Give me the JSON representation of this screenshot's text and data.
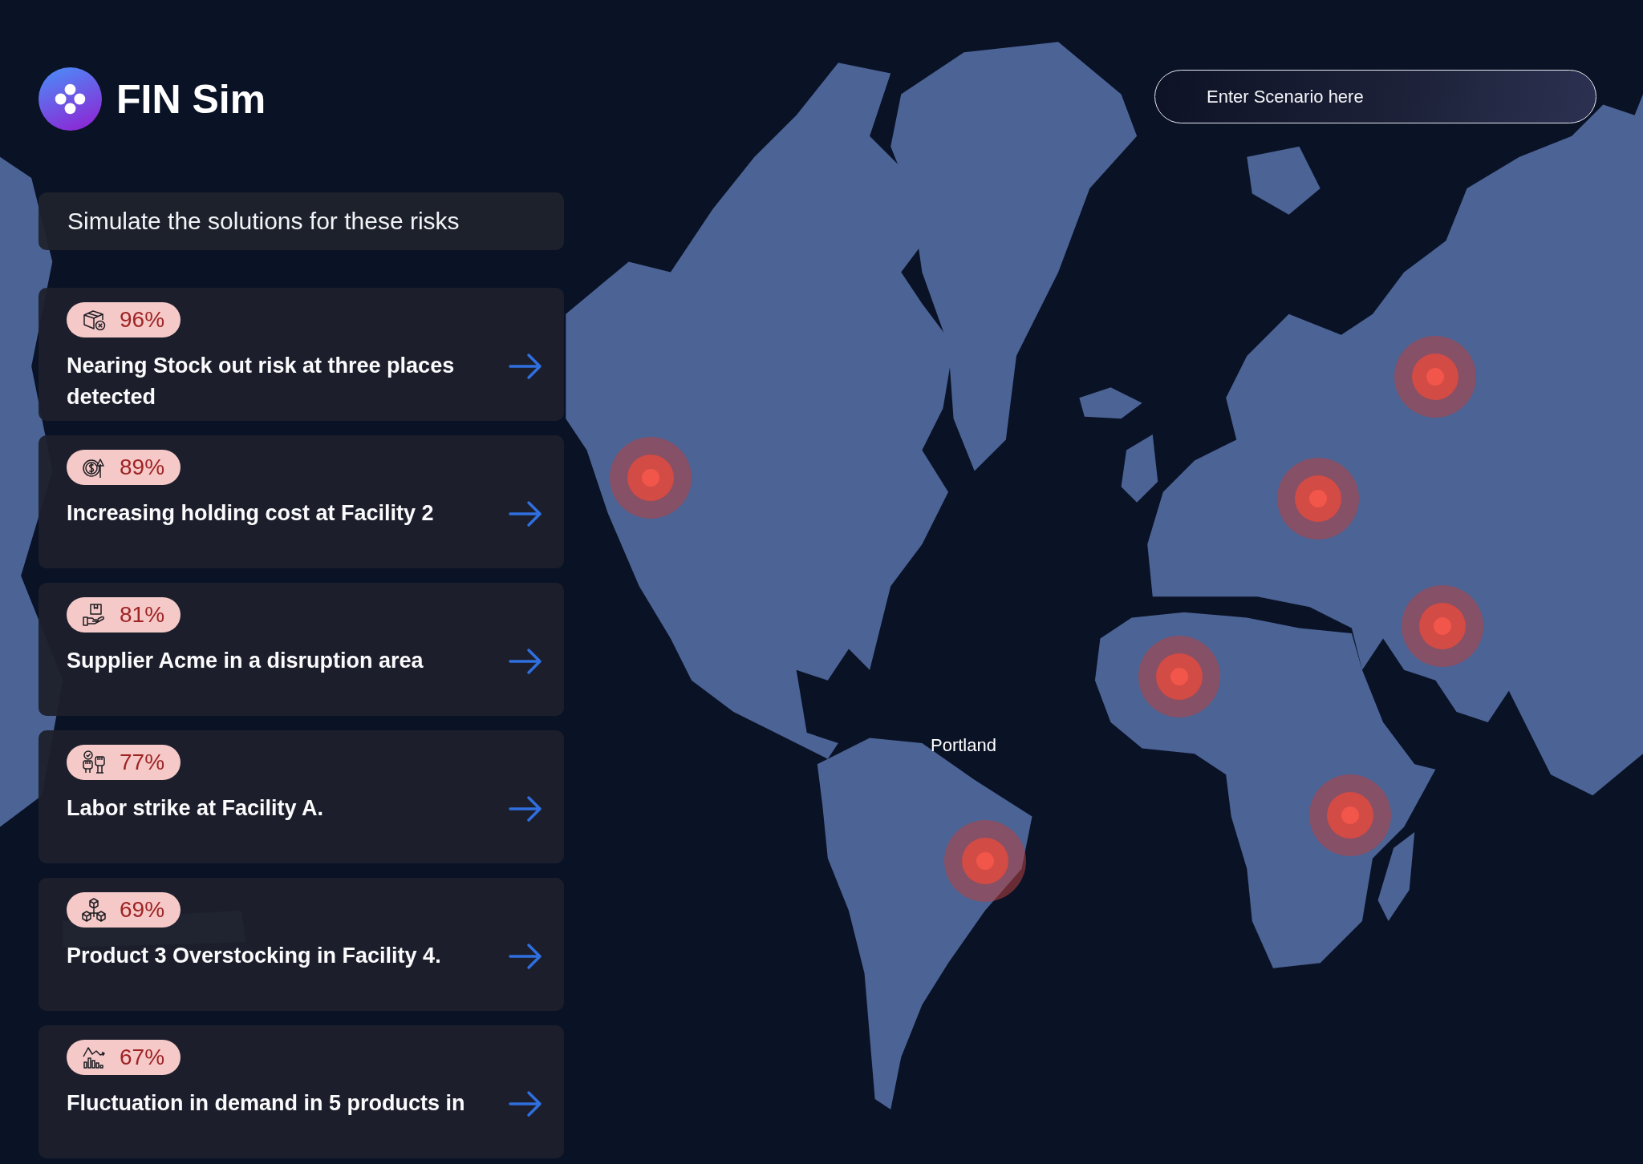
{
  "app": {
    "title": "FIN Sim"
  },
  "search": {
    "placeholder": "Enter Scenario here"
  },
  "risks_panel": {
    "heading": "Simulate the solutions for these risks",
    "risks": [
      {
        "kind": "stockout",
        "score": "96%",
        "title": "Nearing Stock out risk at three places detected"
      },
      {
        "kind": "cost",
        "score": "89%",
        "title": "Increasing holding cost at Facility 2"
      },
      {
        "kind": "supplier",
        "score": "81%",
        "title": "Supplier Acme in a disruption area"
      },
      {
        "kind": "labor",
        "score": "77%",
        "title": "Labor strike at Facility A."
      },
      {
        "kind": "overstock",
        "score": "69%",
        "title": "Product 3 Overstocking in Facility 4."
      },
      {
        "kind": "demand",
        "score": "67%",
        "title": "Fluctuation in demand in 5 products in"
      }
    ]
  },
  "map": {
    "pin_label": "Portland"
  }
}
